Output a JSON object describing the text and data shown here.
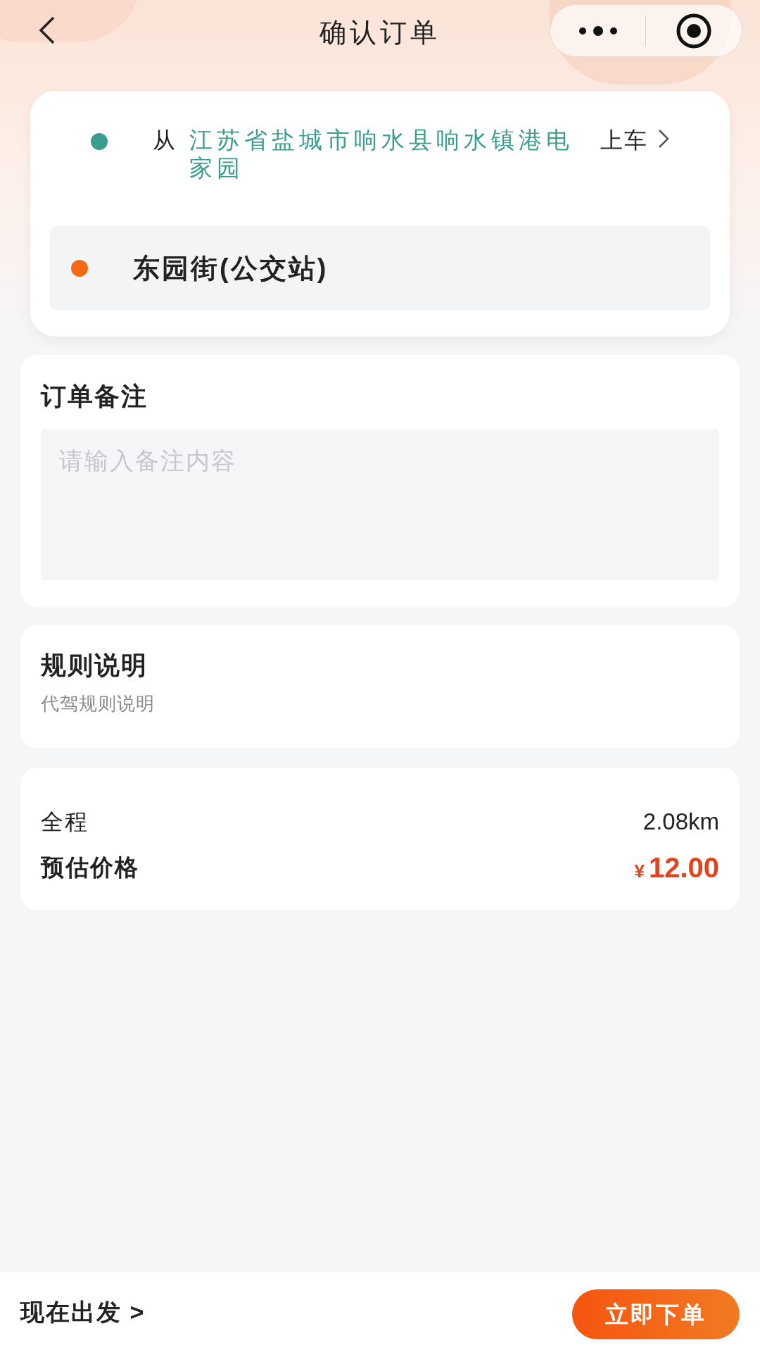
{
  "nav": {
    "title": "确认订单"
  },
  "route": {
    "stops": [
      {
        "kind": "pickup",
        "color": "#3a9d8f",
        "prefix": "从",
        "address": "江苏省盐城市响水县响水镇港电家园",
        "suffix": "上车"
      },
      {
        "kind": "dropoff",
        "color": "#f26a13",
        "address": "东园街(公交站)"
      }
    ]
  },
  "remark": {
    "title": "订单备注",
    "placeholder": "请输入备注内容"
  },
  "rules": {
    "title": "规则说明",
    "text": "代驾规则说明"
  },
  "summary": {
    "distance_label": "全程",
    "distance": "2.08km",
    "price_label": "预估价格",
    "currency": "¥",
    "price": "12.00"
  },
  "footer": {
    "depart": "现在出发 >",
    "submit": "立即下单"
  }
}
